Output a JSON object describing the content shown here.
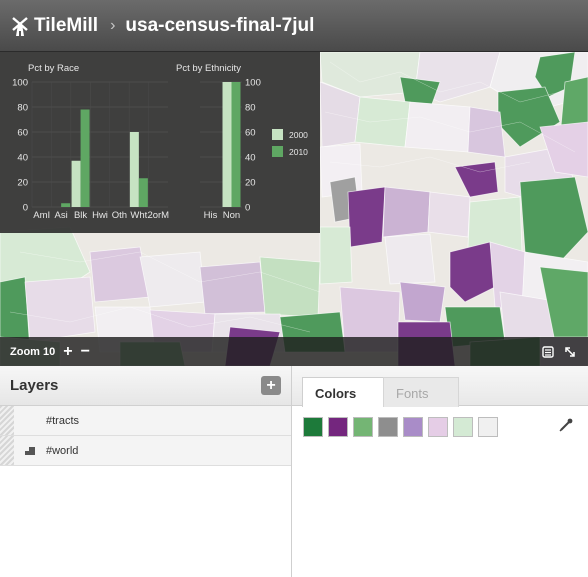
{
  "header": {
    "app_name": "TileMill",
    "separator": "›",
    "project_name": "usa-census-final-7jul"
  },
  "zoombar": {
    "zoom_label": "Zoom 10",
    "zoom_in": "+",
    "zoom_out": "−"
  },
  "layers": {
    "title": "Layers",
    "add_label": "+",
    "items": [
      {
        "name": "#tracts"
      },
      {
        "name": "#world"
      }
    ]
  },
  "styles": {
    "tabs": [
      {
        "label": "Colors"
      },
      {
        "label": "Fonts"
      }
    ],
    "swatches": [
      "#1d7a3a",
      "#74267e",
      "#74b574",
      "#8e8e8e",
      "#a98cc8",
      "#e5cde6",
      "#d4ead4",
      "#f0f0f0"
    ]
  },
  "colors": {
    "green_dark": "#4f9a5c",
    "green_mid": "#8cc58f",
    "green_light": "#d3ead2",
    "purple_dark": "#7a3b8a",
    "purple_mid": "#b990c6",
    "purple_light": "#e3cfe5",
    "series_2000": "#c6e3c2",
    "series_2010": "#5fa763"
  },
  "chart_data": [
    {
      "type": "bar",
      "title": "Pct by Race",
      "categories": [
        "AmI",
        "Asi",
        "Blk",
        "Hwi",
        "Oth",
        "Wht",
        "2orM"
      ],
      "series": [
        {
          "name": "2000",
          "values": [
            0,
            0,
            37,
            0,
            0,
            60,
            0
          ]
        },
        {
          "name": "2010",
          "values": [
            0,
            3,
            78,
            0,
            0,
            23,
            0
          ]
        }
      ],
      "yticks": [
        100,
        80,
        60,
        40,
        20,
        0
      ],
      "ylim": [
        0,
        100
      ]
    },
    {
      "type": "bar",
      "title": "Pct by Ethnicity",
      "categories": [
        "His",
        "Non"
      ],
      "series": [
        {
          "name": "2000",
          "values": [
            0,
            100
          ]
        },
        {
          "name": "2010",
          "values": [
            0,
            100
          ]
        }
      ],
      "yticks": [
        100,
        80,
        60,
        40,
        20,
        0
      ],
      "ylim": [
        0,
        100
      ],
      "legend": [
        "2000",
        "2010"
      ]
    }
  ]
}
